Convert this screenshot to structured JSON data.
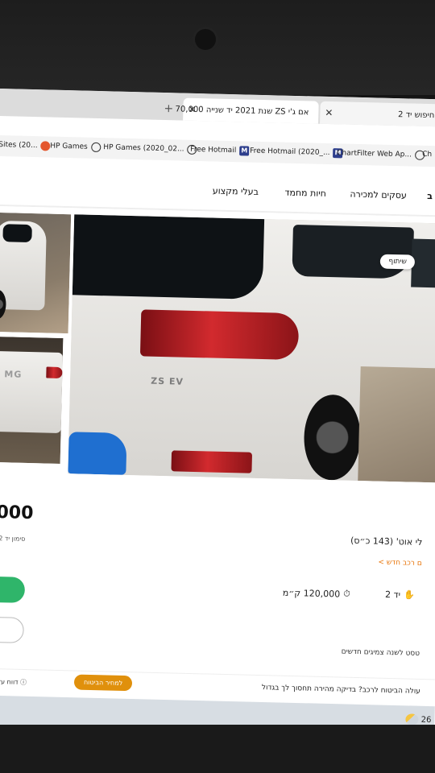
{
  "browser": {
    "tabs": [
      {
        "label": "חיפוש יד 2"
      },
      {
        "label": "אם ג'י ZS שנת 2021 יד שנייה 70,000"
      }
    ],
    "tab_close": "✕",
    "new_tab": "+",
    "bookmarks": [
      {
        "label": "Sites (20...",
        "icon": "sites-icon"
      },
      {
        "label": "HP Games",
        "icon": "hp-icon"
      },
      {
        "label": "HP Games (2020_02...",
        "icon": "globe-icon"
      },
      {
        "label": "Free Hotmail",
        "icon": "globe-icon"
      },
      {
        "label": "Free Hotmail (2020_...",
        "icon": "m-icon"
      },
      {
        "label": "ChartFilter Web Ap...",
        "icon": "m-icon"
      },
      {
        "label": "Ch",
        "icon": "globe-icon"
      }
    ]
  },
  "site_nav": {
    "links": [
      "עסקים למכירה",
      "חיות מחמד",
      "בעלי מקצוע"
    ],
    "right_edge": "ב"
  },
  "gallery": {
    "share_label": "שיתוף",
    "badge_text": "ZS EV"
  },
  "listing": {
    "price": ",000",
    "sign_note": "סימון יד 2 בצ",
    "model": "לי אוט' (143 כ״ס)",
    "new_car_link": "ם רכב חדש >",
    "hand": "יד 2",
    "km": "120,000 ק״מ",
    "test_note": "טסט לשנה צמיגים חדשים"
  },
  "insurance": {
    "text": "עולה הביטוח לרכב? בדיקה מהירה תחסוך לך בגדול",
    "button": "למחיר הביטוח",
    "report": "דווח על מוד"
  },
  "taskbar": {
    "clock": "26"
  }
}
